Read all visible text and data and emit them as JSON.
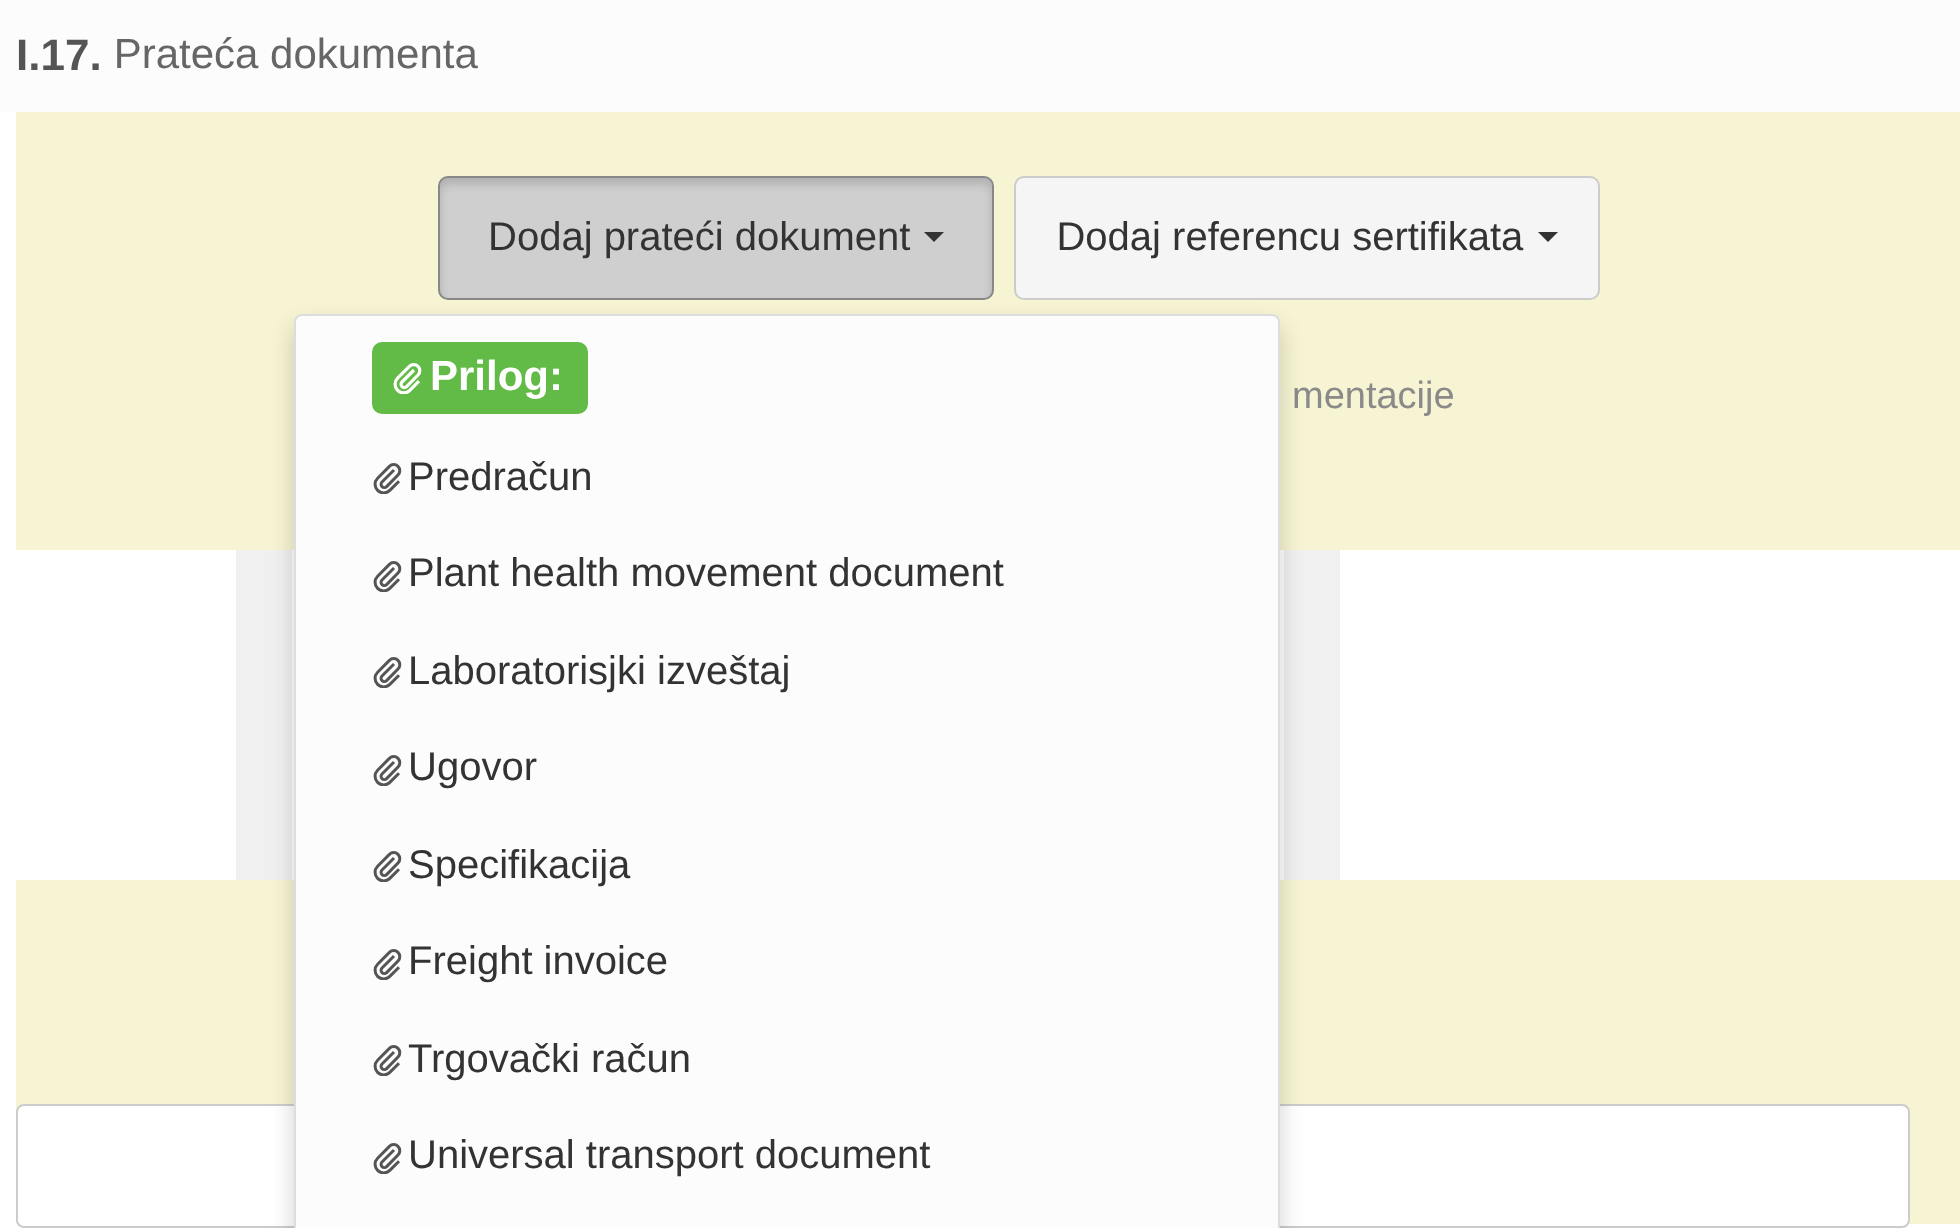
{
  "section": {
    "number": "I.17.",
    "title": "Prateća dokumenta"
  },
  "buttons": [
    {
      "label": "Dodaj prateći dokument",
      "pressed": true
    },
    {
      "label": "Dodaj referencu sertifikata",
      "pressed": false
    }
  ],
  "panel_note": "mentacije",
  "menu": {
    "header": "Prilog:",
    "items": [
      "Predračun",
      "Plant health movement document",
      "Laboratorisjki izveštaj",
      "Ugovor",
      "Specifikacija",
      "Freight invoice",
      "Trgovački račun",
      "Universal transport document"
    ]
  }
}
